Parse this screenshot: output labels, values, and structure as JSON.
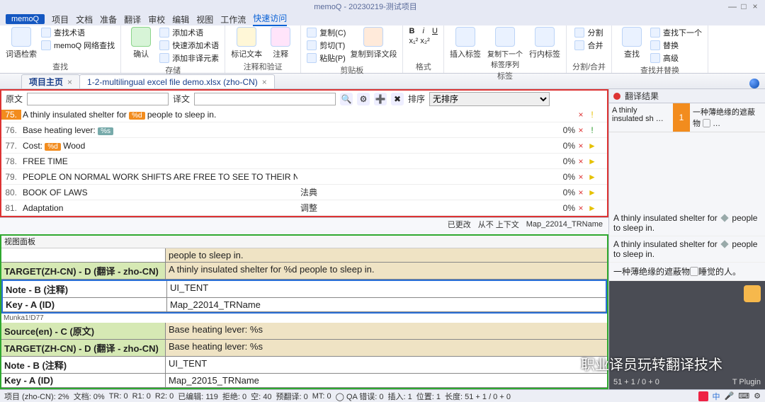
{
  "window": {
    "title": "memoQ - 20230219-测试项目",
    "buttons": [
      "—",
      "□",
      "×"
    ]
  },
  "menubar": {
    "logo": "memoQ",
    "items": [
      "项目",
      "文档",
      "准备",
      "翻译",
      "审校",
      "编辑",
      "视图",
      "工作流",
      "快速访问"
    ],
    "active_index": 8
  },
  "ribbon": {
    "groups": [
      {
        "label": "查找",
        "big": [
          {
            "cap": "词语检索"
          }
        ],
        "small": [
          "查找术语",
          "memoQ 网络查找"
        ]
      },
      {
        "label": "存储",
        "big": [
          {
            "cap": "确认"
          }
        ],
        "small": [
          "添加术语",
          "快速添加术语",
          "添加非译元素"
        ]
      },
      {
        "label": "注释和验证",
        "big": [
          {
            "cap": "标记文本"
          },
          {
            "cap": "注释"
          }
        ],
        "small": []
      },
      {
        "label": "剪贴板",
        "big": [
          {
            "cap": "复制到译文段"
          }
        ],
        "small": [
          "复制(C)",
          "剪切(T)",
          "粘贴(P)"
        ]
      },
      {
        "label": "格式",
        "big": [],
        "small": [
          "B i U",
          "x₁² x₂²"
        ]
      },
      {
        "label": "标签",
        "big": [
          {
            "cap": "插入标签"
          },
          {
            "cap": "复制下一个标签序列"
          },
          {
            "cap": "行内标签"
          }
        ],
        "small": []
      },
      {
        "label": "分割/合并",
        "big": [],
        "small": [
          "分割",
          "合并"
        ]
      },
      {
        "label": "查找并替换",
        "big": [
          {
            "cap": "查找"
          }
        ],
        "small": [
          "查找下一个",
          "替换",
          "高级"
        ]
      }
    ]
  },
  "tabs": [
    {
      "label": "项目主页",
      "closable": true,
      "active": false
    },
    {
      "label": "1-2-multilingual excel file demo.xlsx (zho-CN)",
      "closable": true,
      "active": true
    }
  ],
  "filter": {
    "src_label": "原文",
    "tgt_label": "译文",
    "sort_label": "排序",
    "sort_value": "无排序"
  },
  "rows": [
    {
      "n": "75.",
      "src_pre": "A thinly insulated shelter for ",
      "tag": "%d",
      "src_post": " people to sleep in.",
      "tgt": "",
      "pct": "",
      "f1": "×",
      "f2": "!"
    },
    {
      "n": "76.",
      "src": "Base heating lever: ",
      "tag": "%s",
      "tgt": "",
      "pct": "0%",
      "f1": "×",
      "f2": "!",
      "f2class": "grn"
    },
    {
      "n": "77.",
      "src": "Cost: ",
      "tag": "%d",
      "src_post": " Wood",
      "tgt": "",
      "pct": "0%",
      "f1": "×",
      "f2": "►"
    },
    {
      "n": "78.",
      "src": "FREE TIME",
      "tgt": "",
      "pct": "0%",
      "f1": "×",
      "f2": "►"
    },
    {
      "n": "79.",
      "src": "PEOPLE ON NORMAL WORK SHIFTS ARE FREE TO SEE TO THEIR NEEDS.",
      "tgt": "",
      "pct": "0%",
      "f1": "×",
      "f2": "►"
    },
    {
      "n": "80.",
      "src": "BOOK OF LAWS",
      "tgt": "法典",
      "pct": "0%",
      "f1": "×",
      "f2": "►"
    },
    {
      "n": "81.",
      "src": "Adaptation",
      "tgt": "调整",
      "pct": "0%",
      "f1": "×",
      "f2": "►"
    }
  ],
  "gridstatus": {
    "changed": "已更改",
    "ctx": "从不 上下文",
    "key": "Map_22014_TRName"
  },
  "view_panel": {
    "title": "视图面板",
    "block1": [
      {
        "k": "",
        "v": "people to sleep in.",
        "cls": "tan"
      },
      {
        "k": "TARGET(ZH-CN) - D (翻译 - zho-CN)",
        "v": "A thinly insulated shelter for %d people to sleep in.",
        "cls": "green tan"
      },
      {
        "k": "Note - B (注释)",
        "v": "UI_TENT",
        "cls": "bluebox-start"
      },
      {
        "k": "Key - A (ID)",
        "v": "Map_22014_TRName",
        "cls": "bluebox-end"
      }
    ],
    "munka": "Munka1!D77",
    "block2": [
      {
        "k": "Source(en) - C (原文)",
        "v": "Base heating lever: %s",
        "cls": "green tan"
      },
      {
        "k": "TARGET(ZH-CN) - D (翻译 - zho-CN)",
        "v": "Base heating lever: %s",
        "cls": "green tan"
      },
      {
        "k": "Note - B (注释)",
        "v": "UI_TENT"
      },
      {
        "k": "Key - A (ID)",
        "v": "Map_22015_TRName"
      }
    ]
  },
  "right_header": "翻译结果",
  "tm_hit": {
    "src": "A thinly insulated sh …",
    "score": "1",
    "tgt": "一种薄绝缘的遮蔽物 ▢ …"
  },
  "preview1_pre": "A thinly insulated shelter for ",
  "preview1_post": " people to sleep in.",
  "preview2_pre": "A thinly insulated shelter for ",
  "preview2_post": " people to sleep in.",
  "preview3": "一种薄绝缘的遮蔽物▢睡觉的人。",
  "right_footer_left": "51 + 1 / 0 + 0",
  "right_footer_right": "T Plugin",
  "statusbar": {
    "items": [
      "项目 (zho-CN): 2%",
      "文档: 0%",
      "TR: 0",
      "R1: 0",
      "R2: 0",
      "已编辑: 119",
      "拒绝: 0",
      "空: 40",
      "预翻译: 0",
      "MT: 0",
      "◯ QA 错误: 0",
      "插入: 1",
      "位置: 1",
      "长度: 51 + 1 / 0 + 0"
    ]
  },
  "watermark": "职业译员玩转翻译技术"
}
